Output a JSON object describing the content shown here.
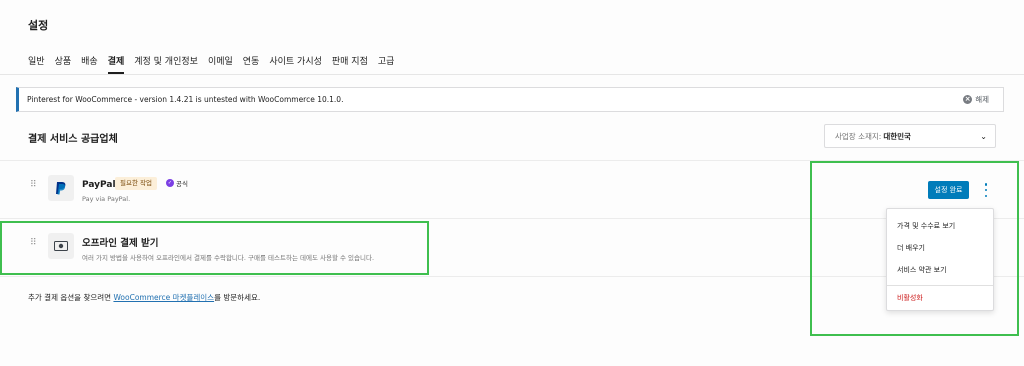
{
  "page": {
    "title": "설정"
  },
  "tabs": [
    {
      "label": "일반"
    },
    {
      "label": "상품"
    },
    {
      "label": "배송"
    },
    {
      "label": "결제"
    },
    {
      "label": "계정 및 개인정보"
    },
    {
      "label": "이메일"
    },
    {
      "label": "연동"
    },
    {
      "label": "사이트 가시성"
    },
    {
      "label": "판매 지점"
    },
    {
      "label": "고급"
    }
  ],
  "active_tab": "결제",
  "notice": {
    "text": "Pinterest for WooCommerce - version 1.4.21 is untested with WooCommerce 10.1.0.",
    "dismiss_label": "해제"
  },
  "section": {
    "title": "결제 서비스 공급업체",
    "country_prefix": "사업장 소재지:",
    "country_value": "대한민국"
  },
  "paypal": {
    "name": "PayPal",
    "badge_action": "필요한 작업",
    "badge_official": "공식",
    "description": "Pay via PayPal.",
    "setup_button": "설정 완료"
  },
  "menu": {
    "items": [
      "가격 및 수수료 보기",
      "더 배우기",
      "서비스 약관 보기"
    ],
    "disable": "비활성화"
  },
  "offline": {
    "name": "오프라인 결제 받기",
    "description": "여러 가지 방법을 사용하여 오프라인에서 결제를 수락합니다. 구매를 테스트하는 데에도 사용할 수 있습니다."
  },
  "footer": {
    "prefix": "추가 결제 옵션을 찾으려면 ",
    "link": "WooCommerce 마켓플레이스",
    "suffix": "를 방문하세요."
  },
  "colors": {
    "accent": "#007cba",
    "highlight": "#3fbf4f",
    "danger": "#cc1818"
  }
}
